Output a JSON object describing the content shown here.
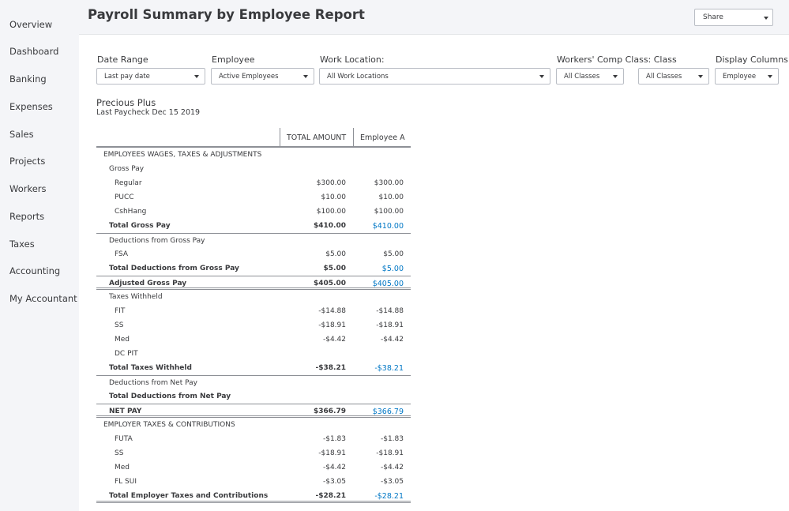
{
  "sidebar": {
    "items": [
      {
        "label": "Overview"
      },
      {
        "label": "Dashboard"
      },
      {
        "label": "Banking"
      },
      {
        "label": "Expenses"
      },
      {
        "label": "Sales"
      },
      {
        "label": "Projects"
      },
      {
        "label": "Workers"
      },
      {
        "label": "Reports"
      },
      {
        "label": "Taxes"
      },
      {
        "label": "Accounting"
      },
      {
        "label": "My Accountant"
      }
    ]
  },
  "header": {
    "title": "Payroll Summary by Employee Report",
    "share_label": "Share"
  },
  "filters": {
    "date_range": {
      "label": "Date Range",
      "value": "Last pay date"
    },
    "employee": {
      "label": "Employee",
      "value": "Active Employees"
    },
    "work_location": {
      "label": "Work Location:",
      "value": "All Work Locations"
    },
    "comp_class": {
      "label": "Workers' Comp Class: Class",
      "value": "All Classes",
      "class_value": "All Classes"
    },
    "display_columns": {
      "label": "Display Columns by",
      "value": "Employee"
    }
  },
  "report": {
    "company": "Precious Plus",
    "subtitle": "Last Paycheck Dec 15 2019",
    "columns": [
      "TOTAL AMOUNT",
      "Employee A"
    ],
    "rows": [
      {
        "label": "EMPLOYEES WAGES, TAXES & ADJUSTMENTS",
        "total": "",
        "emp": ""
      },
      {
        "label": "Gross Pay",
        "total": "",
        "emp": ""
      },
      {
        "label": "Regular",
        "total": "$300.00",
        "emp": "$300.00"
      },
      {
        "label": "PUCC",
        "total": "$10.00",
        "emp": "$10.00"
      },
      {
        "label": "CshHang",
        "total": "$100.00",
        "emp": "$100.00"
      },
      {
        "label": "Total Gross Pay",
        "total": "$410.00",
        "emp": "$410.00"
      },
      {
        "label": "Deductions from Gross Pay",
        "total": "",
        "emp": ""
      },
      {
        "label": "FSA",
        "total": "$5.00",
        "emp": "$5.00"
      },
      {
        "label": "Total Deductions from Gross Pay",
        "total": "$5.00",
        "emp": "$5.00"
      },
      {
        "label": "Adjusted Gross Pay",
        "total": "$405.00",
        "emp": "$405.00"
      },
      {
        "label": "Taxes Withheld",
        "total": "",
        "emp": ""
      },
      {
        "label": "FIT",
        "total": "-$14.88",
        "emp": "-$14.88"
      },
      {
        "label": "SS",
        "total": "-$18.91",
        "emp": "-$18.91"
      },
      {
        "label": "Med",
        "total": "-$4.42",
        "emp": "-$4.42"
      },
      {
        "label": "DC PIT",
        "total": "",
        "emp": ""
      },
      {
        "label": "Total Taxes Withheld",
        "total": "-$38.21",
        "emp": "-$38.21"
      },
      {
        "label": "Deductions from Net Pay",
        "total": "",
        "emp": ""
      },
      {
        "label": "Total Deductions from Net Pay",
        "total": "",
        "emp": ""
      },
      {
        "label": "NET PAY",
        "total": "$366.79",
        "emp": "$366.79"
      },
      {
        "label": "EMPLOYER TAXES & CONTRIBUTIONS",
        "total": "",
        "emp": ""
      },
      {
        "label": "FUTA",
        "total": "-$1.83",
        "emp": "-$1.83"
      },
      {
        "label": "SS",
        "total": "-$18.91",
        "emp": "-$18.91"
      },
      {
        "label": "Med",
        "total": "-$4.42",
        "emp": "-$4.42"
      },
      {
        "label": "FL SUI",
        "total": "-$3.05",
        "emp": "-$3.05"
      },
      {
        "label": "Total Employer Taxes and Contributions",
        "total": "-$28.21",
        "emp": "-$28.21"
      }
    ]
  },
  "colors": {
    "link": "#0077c5",
    "sidebar_bg": "#f4f5f8",
    "text": "#393a3d"
  }
}
